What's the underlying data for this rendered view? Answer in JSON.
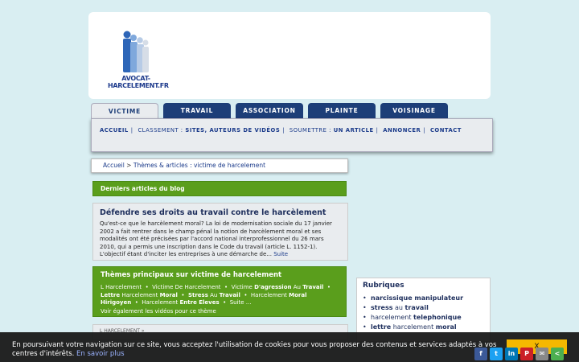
{
  "logo": {
    "line1": "AVOCAT-",
    "line2": "HARCELEMENT.FR"
  },
  "tabs": [
    {
      "label": "VICTIME"
    },
    {
      "label": "TRAVAIL"
    },
    {
      "label": "ASSOCIATION"
    },
    {
      "label": "PLAINTE"
    },
    {
      "label": "VOISINAGE"
    }
  ],
  "subnav": {
    "accueil": "ACCUEIL",
    "classement_prefix": "CLASSEMENT :",
    "classement_link": "SITES, AUTEURS DE VIDÉOS",
    "soumettre_prefix": "SOUMETTRE :",
    "soumettre_link": "UN ARTICLE",
    "annoncer": "ANNONCER",
    "contact": "CONTACT"
  },
  "breadcrumb": {
    "home": "Accueil",
    "separator": ">",
    "current": "Thèmes & articles : victime de harcelement"
  },
  "latest_bar": {
    "title": "Derniers articles du blog"
  },
  "article": {
    "title": "Défendre ses droits au travail contre le harcèlement",
    "body": "Qu'est-ce que le harcèlement moral? La loi de modernisation sociale du 17 janvier 2002 a fait rentrer dans le champ pénal la notion de harcèlement moral et ses modalités ont été précisées par l'accord national interprofessionnel du 26 mars 2010, qui a permis une inscription dans le Code du travail (article L. 1152-1). L'objectif étant d'inciter les entreprises à une démarche de...",
    "more": "Suite"
  },
  "themes": {
    "title": "Thèmes principaux sur victime de harcelement",
    "t1": "L Harcelement",
    "t2": "Victime De Harcelement",
    "t3a": "Victime ",
    "t3b": "D'agression",
    "t3c": " Au ",
    "t3d": "Travail",
    "t4a": "Lettre",
    "t4b": " Harcelement ",
    "t4c": "Moral",
    "t5a": "Stress",
    "t5b": " Au ",
    "t5c": "Travail",
    "t6a": "Harcelement ",
    "t6b": "Moral",
    "t7": "Hirigoyen",
    "t8a": "Harcelement ",
    "t8b": "Entre Eleves",
    "t9": "Suite ...",
    "bullet": "•",
    "videos_prefix": "Voir également",
    "videos_link": "les vidéos",
    "videos_suffix": "pour ce thème"
  },
  "related": {
    "label": "L HARCELEMENT »"
  },
  "rubriques": {
    "title": "Rubriques",
    "items": [
      {
        "pre": "",
        "bold": "narcissique manipulateur",
        "post": ""
      },
      {
        "pre": "",
        "bold": "stress",
        "post": " au ",
        "bold2": "travail"
      },
      {
        "pre": "harcelement ",
        "bold": "telephonique",
        "post": ""
      },
      {
        "pre": "",
        "bold": "lettre",
        "post": " harcelement ",
        "bold2": "moral"
      }
    ]
  },
  "cookie": {
    "text": "En poursuivant votre navigation sur ce site, vous acceptez l'utilisation de cookies pour vous proposer des contenus et services adaptés à vos centres d'intérêts.",
    "link": "En savoir plus",
    "button": "X"
  },
  "share": [
    {
      "name": "facebook",
      "glyph": "f",
      "color": "#3b5998"
    },
    {
      "name": "twitter",
      "glyph": "t",
      "color": "#1da1f2"
    },
    {
      "name": "linkedin",
      "glyph": "in",
      "color": "#0077b5"
    },
    {
      "name": "pinterest",
      "glyph": "P",
      "color": "#cb2027"
    },
    {
      "name": "email",
      "glyph": "✉",
      "color": "#888888"
    },
    {
      "name": "share",
      "glyph": "<",
      "color": "#4caf50"
    }
  ],
  "colors": {
    "nav": "#1d3e78",
    "green": "#5a9e1c",
    "background": "#d9eef2"
  }
}
